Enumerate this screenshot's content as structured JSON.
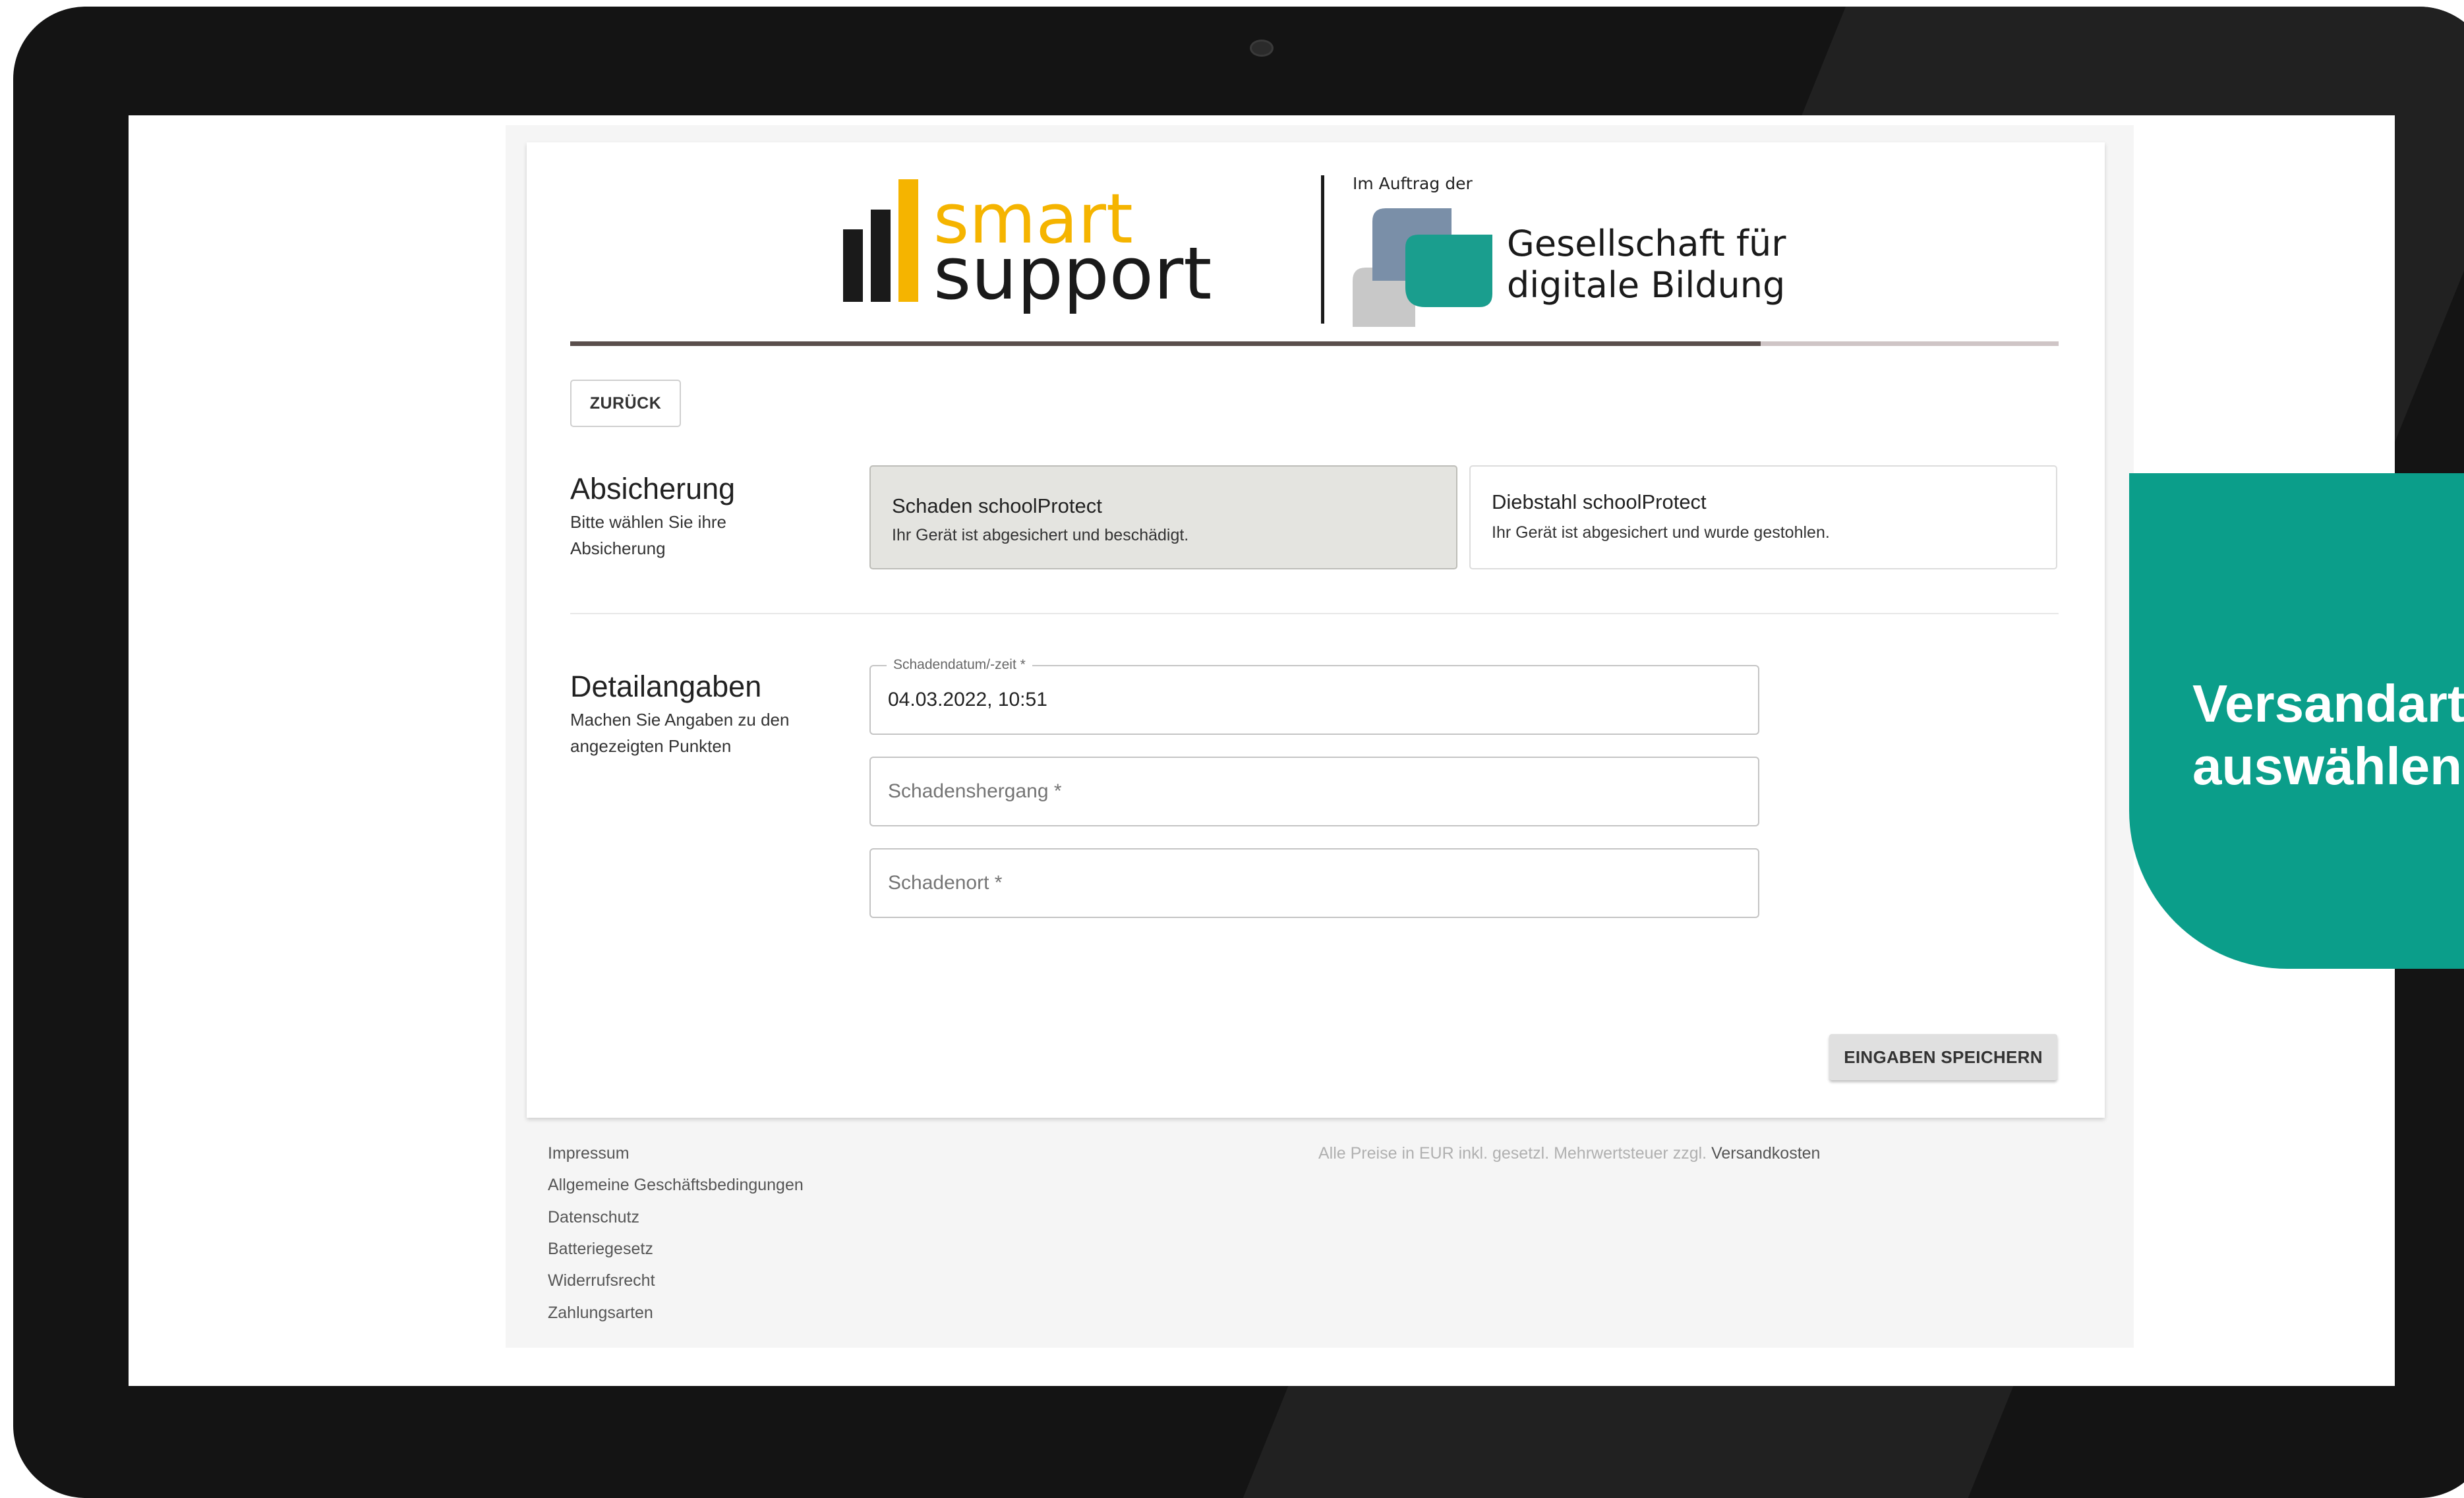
{
  "brand": {
    "logo_word1": "smart",
    "logo_word2": "support",
    "partner_prefix": "Im Auftrag der",
    "partner_line1": "Gesellschaft für",
    "partner_line2": "digitale Bildung",
    "colors": {
      "accent": "#f5b400",
      "dark": "#1a1a1a",
      "teal": "#1a9e8e",
      "slate": "#7a8fa8"
    }
  },
  "progress": {
    "value_percent": 80
  },
  "nav": {
    "back_label": "ZURÜCK"
  },
  "absicherung": {
    "title": "Absicherung",
    "subtitle": "Bitte wählen Sie ihre Absicherung",
    "options": [
      {
        "title": "Schaden schoolProtect",
        "desc": "Ihr Gerät ist abgesichert und beschädigt.",
        "selected": true
      },
      {
        "title": "Diebstahl schoolProtect",
        "desc": "Ihr Gerät ist abgesichert und wurde gestohlen.",
        "selected": false
      }
    ]
  },
  "details": {
    "title": "Detailangaben",
    "subtitle": "Machen Sie Angaben zu den angezeigten Punkten",
    "fields": [
      {
        "label": "Schadendatum/-zeit *",
        "value": "04.03.2022, 10:51"
      },
      {
        "placeholder": "Schadenshergang *"
      },
      {
        "placeholder": "Schadenort *"
      }
    ],
    "save_label": "EINGABEN SPEICHERN"
  },
  "footer": {
    "links": [
      "Impressum",
      "Allgemeine Geschäftsbedingungen",
      "Datenschutz",
      "Batteriegesetz",
      "Widerrufsrecht",
      "Zahlungsarten"
    ],
    "note": "Alle Preise in EUR inkl. gesetzl. Mehrwertsteuer zzgl.",
    "note_link": "Versandkosten"
  },
  "callout": {
    "line1": "Versandart",
    "line2": "auswählen"
  }
}
